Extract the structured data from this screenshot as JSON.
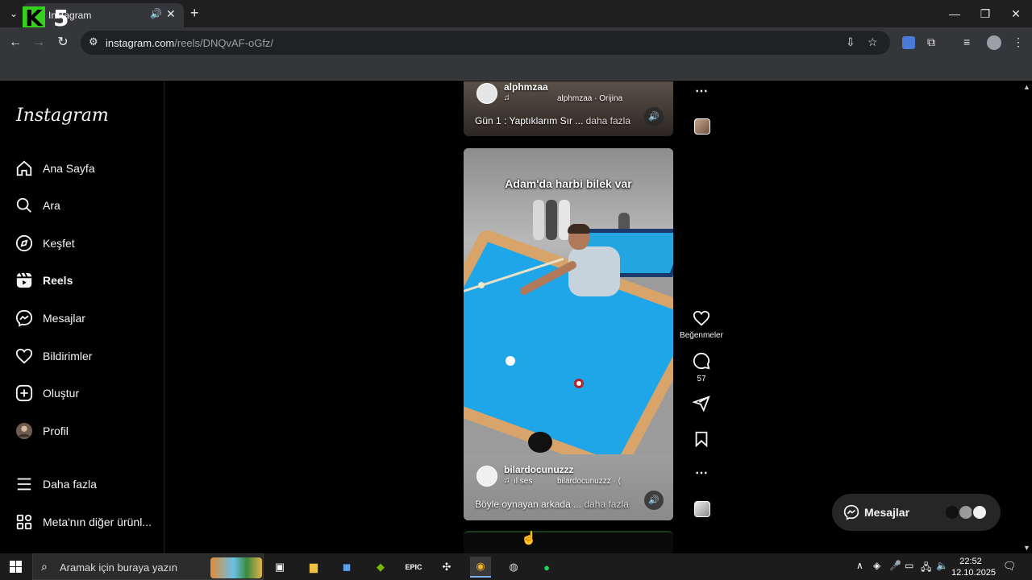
{
  "browser": {
    "tab_title": "Instagram",
    "url_host": "instagram.com",
    "url_path": "/reels/DNQvAF-oGfz/",
    "logo_k": "K",
    "logo_5": "5"
  },
  "sidebar": {
    "logo": "Instagram",
    "items": [
      {
        "label": "Ana Sayfa",
        "icon": "home-icon"
      },
      {
        "label": "Ara",
        "icon": "search-icon"
      },
      {
        "label": "Keşfet",
        "icon": "compass-icon"
      },
      {
        "label": "Reels",
        "icon": "reels-icon",
        "active": true
      },
      {
        "label": "Mesajlar",
        "icon": "messenger-icon"
      },
      {
        "label": "Bildirimler",
        "icon": "heart-icon"
      },
      {
        "label": "Oluştur",
        "icon": "plus-square-icon"
      },
      {
        "label": "Profil",
        "icon": "avatar"
      },
      {
        "label": "Daha fazla",
        "icon": "menu-icon"
      },
      {
        "label": "Meta'nın diğer ürünl...",
        "icon": "apps-icon"
      }
    ]
  },
  "reels": {
    "top": {
      "username": "alphmzaa",
      "audio": "alphmzaa · Orijina",
      "caption": "Gün 1 : Yaptıklarım Sır ...",
      "more": "daha fazla"
    },
    "main": {
      "overlay_text": "Adam'da harbi bilek var",
      "username": "bilardocunuzzz",
      "audio_prefix": "ıl ses",
      "audio": "bilardocunuzzz · (",
      "caption": "Böyle oynayan arkada ...",
      "more": "daha fazla"
    }
  },
  "actions": {
    "likes_label": "Beğenmeler",
    "comments_count": "57"
  },
  "messages_pill": {
    "label": "Mesajlar"
  },
  "taskbar": {
    "search_placeholder": "Aramak için buraya yazın",
    "time": "22:52",
    "date": "12.10.2025"
  }
}
